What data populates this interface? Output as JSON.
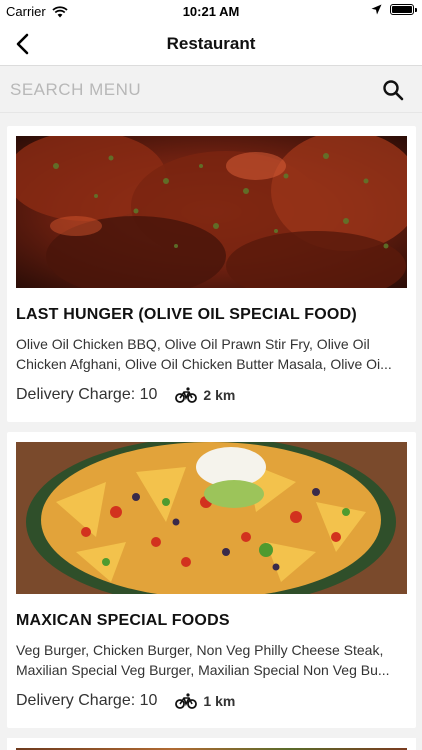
{
  "status_bar": {
    "carrier": "Carrier",
    "time": "10:21 AM"
  },
  "navbar": {
    "title": "Restaurant",
    "back_icon": "chevron-left-icon"
  },
  "search": {
    "placeholder": "SEARCH MENU",
    "value": "",
    "icon": "search-icon"
  },
  "restaurants": [
    {
      "name": "LAST HUNGER (OLIVE OIL SPECIAL FOOD)",
      "menu": "Olive Oil Chicken BBQ, Olive Oil Prawn Stir Fry, Olive Oil Chicken Afghani, Olive Oil Chicken Butter Masala, Olive Oi...",
      "delivery_charge": "Delivery Charge: 10",
      "distance": "2 km"
    },
    {
      "name": "MAXICAN SPECIAL FOODS",
      "menu": "Veg Burger, Chicken Burger, Non Veg Philly Cheese Steak, Maxilian Special Veg Burger, Maxilian Special Non Veg Bu...",
      "delivery_charge": "Delivery Charge: 10",
      "distance": "1 km"
    }
  ],
  "colors": {
    "background": "#f2f2f2",
    "card": "#ffffff",
    "text": "#111111",
    "placeholder": "#b8b8b8"
  }
}
